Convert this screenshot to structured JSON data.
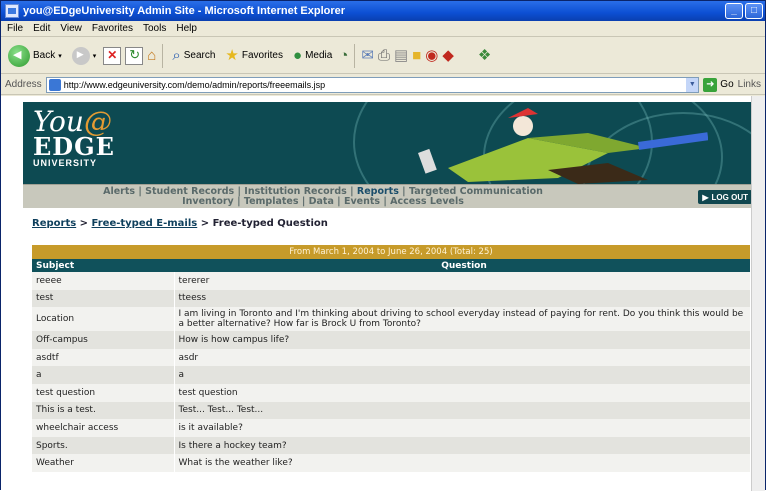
{
  "window": {
    "title": "you@EDgeUniversity Admin Site - Microsoft Internet Explorer",
    "controls": [
      "_",
      "□"
    ]
  },
  "menu": [
    "File",
    "Edit",
    "View",
    "Favorites",
    "Tools",
    "Help"
  ],
  "toolbar": {
    "back": "Back",
    "search": "Search",
    "favorites": "Favorites",
    "media": "Media"
  },
  "address": {
    "label": "Address",
    "url": "http://www.edgeuniversity.com/demo/admin/reports/freeemails.jsp",
    "go": "Go",
    "links": "Links"
  },
  "banner": {
    "logo_you": "You",
    "logo_at": "@",
    "logo_edge": "EDGE",
    "logo_university": "UNIVERSITY"
  },
  "nav": {
    "items": [
      "Alerts",
      "Student Records",
      "Institution Records",
      "Reports",
      "Targeted Communication",
      "Inventory",
      "Templates",
      "Data",
      "Events",
      "Access Levels"
    ],
    "logout": "LOG OUT"
  },
  "breadcrumb": {
    "reports": "Reports",
    "sep": ">",
    "free_emails": "Free-typed E-mails",
    "current": "Free-typed Question"
  },
  "report": {
    "range": "From March 1, 2004 to June 26, 2004   (Total: 25)",
    "col_subject": "Subject",
    "col_question": "Question",
    "rows": [
      {
        "subject": "reeee",
        "question": "tererer"
      },
      {
        "subject": "test",
        "question": "tteess"
      },
      {
        "subject": "Location",
        "question": "I am living in Toronto and I'm thinking about driving to school everyday instead of paying for rent. Do you think this would be a better alternative? How far is Brock U from Toronto?"
      },
      {
        "subject": "Off-campus",
        "question": "How is how campus life?"
      },
      {
        "subject": "asdtf",
        "question": "asdr"
      },
      {
        "subject": "a",
        "question": "a"
      },
      {
        "subject": "test question",
        "question": "test question"
      },
      {
        "subject": "This is a test.",
        "question": "Test... Test... Test..."
      },
      {
        "subject": "wheelchair access",
        "question": "is it available?"
      },
      {
        "subject": "Sports.",
        "question": "Is there a hockey team?"
      },
      {
        "subject": "Weather",
        "question": "What is the weather like?"
      }
    ]
  }
}
